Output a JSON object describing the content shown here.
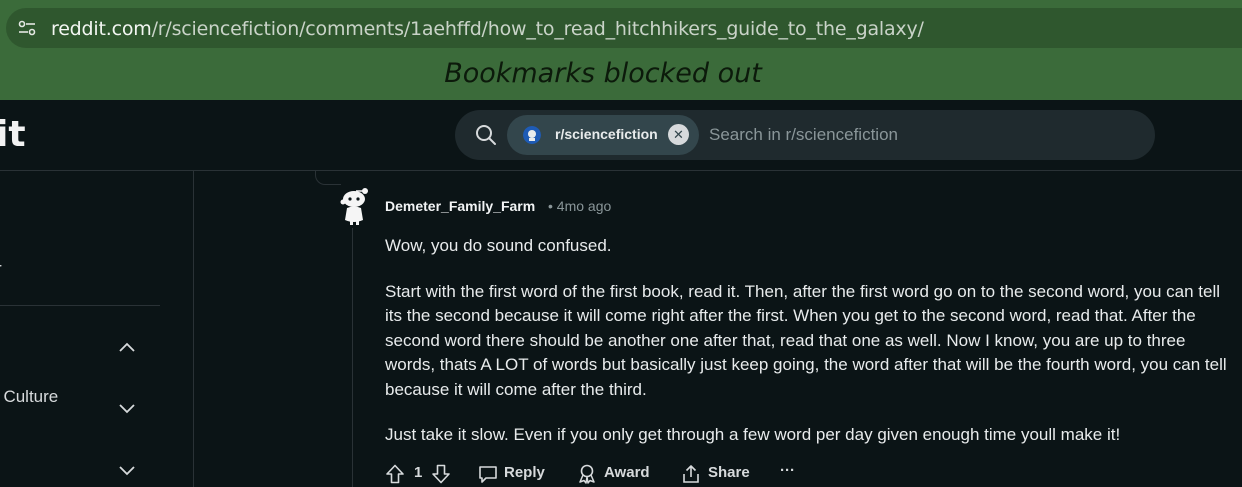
{
  "browser": {
    "url_host": "reddit.com",
    "url_path": "/r/sciencefiction/comments/1aehffd/how_to_read_hitchhikers_guide_to_the_galaxy/",
    "bookmarks_note": "Bookmarks blocked out",
    "icons": [
      "tune-icon"
    ]
  },
  "header": {
    "logo_text": "it",
    "search": {
      "community_chip": "r/sciencefiction",
      "placeholder": "Search in r/sciencefiction"
    }
  },
  "sidebar": {
    "item_partial": "r",
    "item_culture": "t Culture"
  },
  "comment": {
    "author": "Demeter_Family_Farm",
    "time": "• 4mo ago",
    "paragraphs": [
      "Wow, you do sound confused.",
      "Start with the first word of the first book, read it. Then, after the first word go on to the second word, you can tell its the second because it will come right after the first. When you get to the second word, read that. After the second word there should be another one after that, read that one as well. Now I know, you are up to three words, thats A LOT of words but basically just keep going, the word after that will be the fourth word, you can tell because it will come after the third.",
      "Just take it slow. Even if you only get through a few word per day given enough time youll make it!"
    ],
    "actions": {
      "vote_count": "1",
      "reply": "Reply",
      "award": "Award",
      "share": "Share",
      "more": "···"
    }
  },
  "colors": {
    "page_bg": "#0b1416",
    "browser_bg": "#3b6b3a",
    "search_bg": "#1f2a2e",
    "chip_bg": "#33464c"
  }
}
